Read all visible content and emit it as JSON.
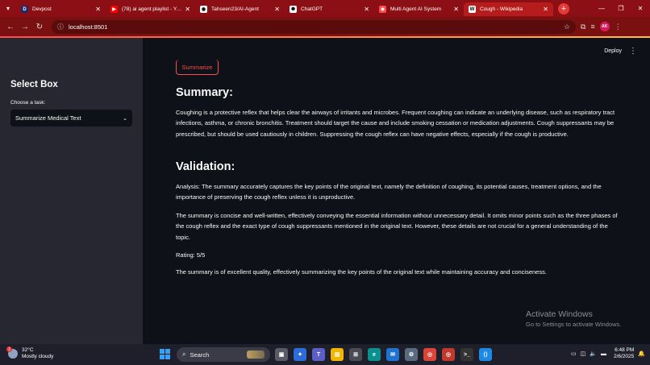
{
  "browser": {
    "tabs": [
      {
        "title": "Devpost",
        "icon": "devpost-icon",
        "color": "#1a2b6b",
        "glyph": "D"
      },
      {
        "title": "(78) ai agent playlist - YouT",
        "icon": "youtube-icon",
        "color": "#ff0000",
        "glyph": "▶"
      },
      {
        "title": "Tahseen23/AI-Agent",
        "icon": "github-icon",
        "color": "#ffffff",
        "glyph": "◉"
      },
      {
        "title": "ChatGPT",
        "icon": "chatgpt-icon",
        "color": "#ffffff",
        "glyph": "✺"
      },
      {
        "title": "Multi Agent AI System",
        "icon": "streamlit-icon",
        "color": "#ff4b4b",
        "glyph": "◆"
      },
      {
        "title": "Cough - Wikipedia",
        "icon": "wikipedia-icon",
        "color": "#ffffff",
        "glyph": "W"
      }
    ],
    "url": "localhost:8501",
    "profile_initials": "AK"
  },
  "sidebar": {
    "title": "Select Box",
    "task_label": "Choose a task:",
    "task_value": "Summarize Medical Text"
  },
  "header": {
    "deploy_label": "Deploy"
  },
  "main": {
    "summarize_button": "Summarize",
    "summary_heading": "Summary:",
    "summary_text": "Coughing is a protective reflex that helps clear the airways of irritants and microbes. Frequent coughing can indicate an underlying disease, such as respiratory tract infections, asthma, or chronic bronchitis. Treatment should target the cause and include smoking cessation or medication adjustments. Cough suppressants may be prescribed, but should be used cautiously in children. Suppressing the cough reflex can have negative effects, especially if the cough is productive.",
    "validation_heading": "Validation:",
    "analysis_text": "Analysis: The summary accurately captures the key points of the original text, namely the definition of coughing, its potential causes, treatment options, and the importance of preserving the cough reflex unless it is unproductive.",
    "detail_text": "The summary is concise and well-written, effectively conveying the essential information without unnecessary detail. It omits minor points such as the three phases of the cough reflex and the exact type of cough suppressants mentioned in the original text. However, these details are not crucial for a general understanding of the topic.",
    "rating_text": "Rating: 5/5",
    "conclusion_text": "The summary is of excellent quality, effectively summarizing the key points of the original text while maintaining accuracy and conciseness."
  },
  "watermark": {
    "line1": "Activate Windows",
    "line2": "Go to Settings to activate Windows."
  },
  "taskbar": {
    "weather_temp": "32°C",
    "weather_desc": "Mostly cloudy",
    "weather_badge": "1",
    "search_placeholder": "Search",
    "time": "6:48 PM",
    "date": "2/6/2025"
  }
}
